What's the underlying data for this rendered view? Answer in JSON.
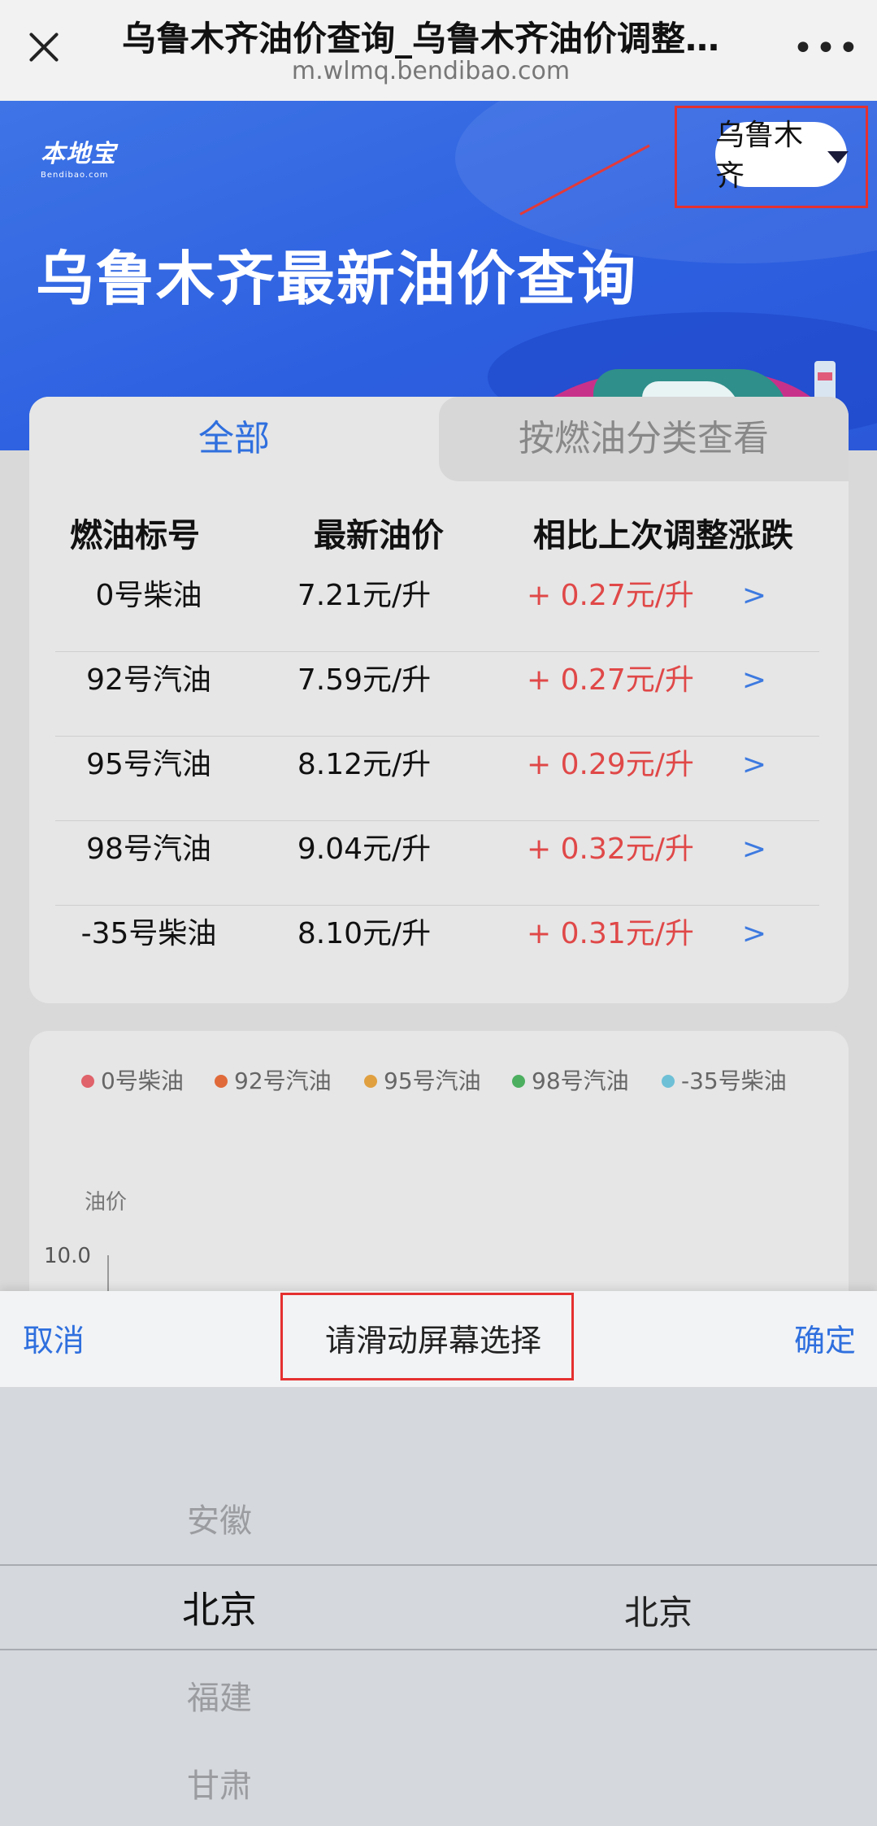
{
  "browser": {
    "title": "乌鲁木齐油价查询_乌鲁木齐油价调整最新消息",
    "url": "m.wlmq.bendibao.com",
    "more": "•••"
  },
  "banner": {
    "logo_main": "本地宝",
    "logo_sub": "Bendibao.com",
    "title": "乌鲁木齐最新油价查询",
    "city": "乌鲁木齐"
  },
  "tabs": {
    "all": "全部",
    "by_fuel": "按燃油分类查看"
  },
  "table": {
    "headers": [
      "燃油标号",
      "最新油价",
      "相比上次调整涨跌"
    ],
    "rows": [
      {
        "fuel": "0号柴油",
        "price": "7.21元/升",
        "change": "+ 0.27元/升",
        "arrow": ">"
      },
      {
        "fuel": "92号汽油",
        "price": "7.59元/升",
        "change": "+ 0.27元/升",
        "arrow": ">"
      },
      {
        "fuel": "95号汽油",
        "price": "8.12元/升",
        "change": "+ 0.29元/升",
        "arrow": ">"
      },
      {
        "fuel": "98号汽油",
        "price": "9.04元/升",
        "change": "+ 0.32元/升",
        "arrow": ">"
      },
      {
        "fuel": "-35号柴油",
        "price": "8.10元/升",
        "change": "+ 0.31元/升",
        "arrow": ">"
      }
    ]
  },
  "chart": {
    "legend": [
      {
        "name": "0号柴油",
        "color": "#e0626a"
      },
      {
        "name": "92号汽油",
        "color": "#e06a3a"
      },
      {
        "name": "95号汽油",
        "color": "#e0a040"
      },
      {
        "name": "98号汽油",
        "color": "#4caf60"
      },
      {
        "name": "-35号柴油",
        "color": "#6ec0d6"
      }
    ],
    "ylabel": "油价",
    "ytick_top": "10.0"
  },
  "picker": {
    "cancel": "取消",
    "hint": "请滑动屏幕选择",
    "confirm": "确定",
    "provinces": [
      "安徽",
      "北京",
      "福建",
      "甘肃"
    ],
    "cities": [
      "北京"
    ]
  },
  "colors": {
    "accent": "#2f6fde",
    "rise": "#e04848",
    "banner": "#2c5fe0"
  }
}
